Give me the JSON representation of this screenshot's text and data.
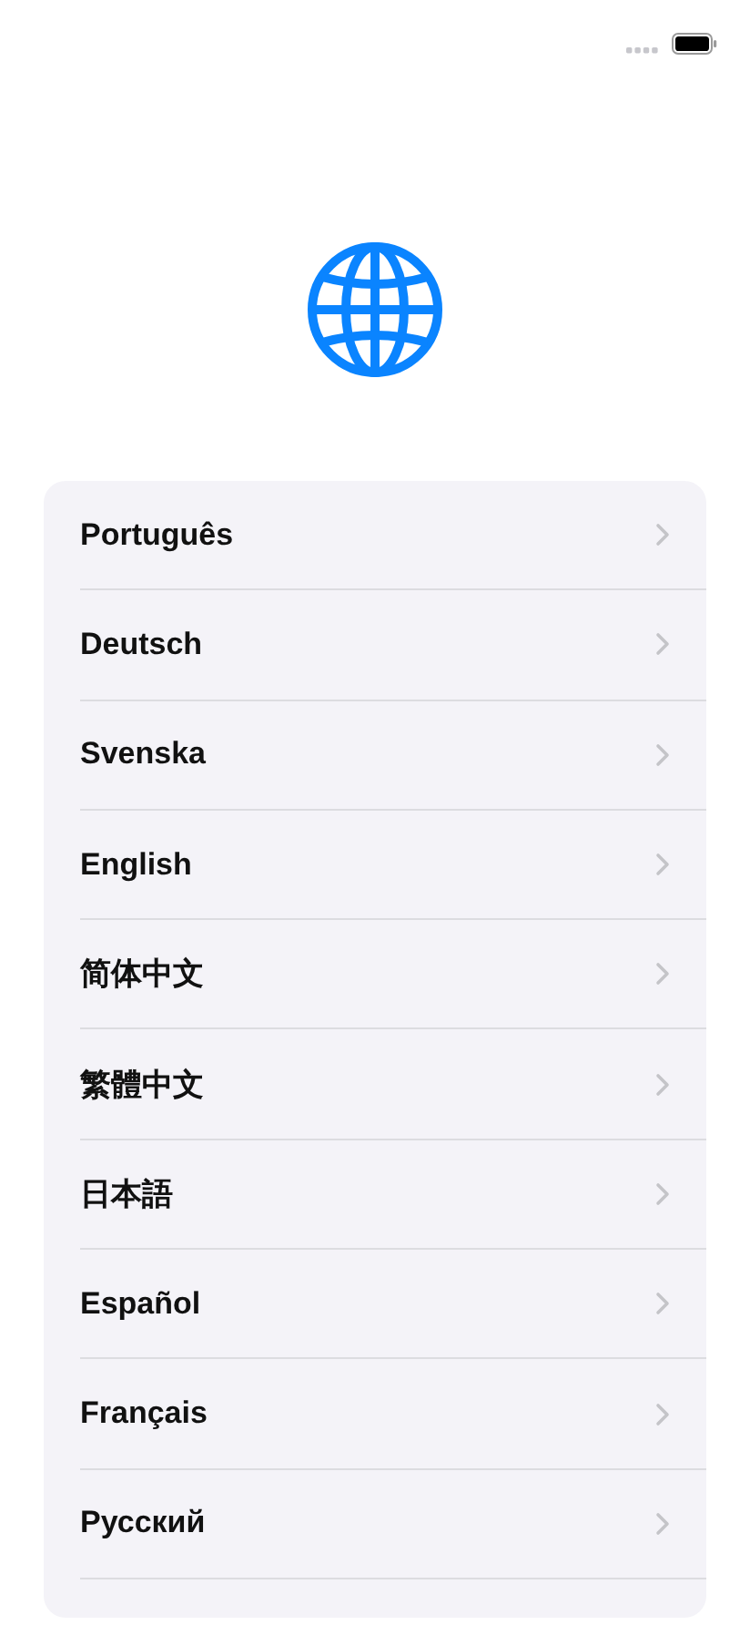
{
  "languages": [
    {
      "label": "Português"
    },
    {
      "label": "Deutsch"
    },
    {
      "label": "Svenska"
    },
    {
      "label": "English"
    },
    {
      "label": "简体中文"
    },
    {
      "label": "繁體中文"
    },
    {
      "label": "日本語"
    },
    {
      "label": "Español"
    },
    {
      "label": "Français"
    },
    {
      "label": "Русский"
    }
  ]
}
